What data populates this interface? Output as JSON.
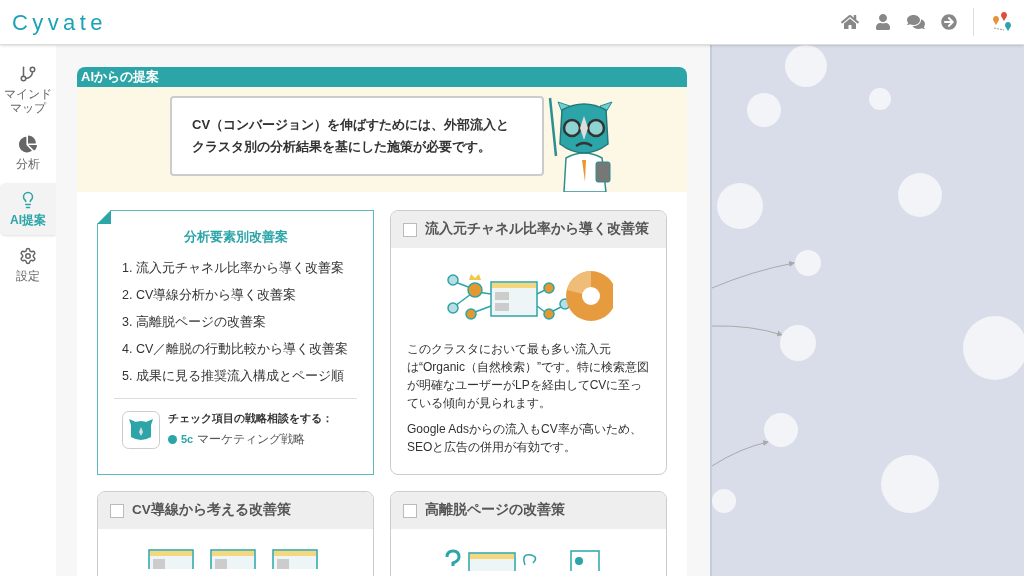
{
  "header": {
    "logo": "Cyvate"
  },
  "sidebar": {
    "items": [
      {
        "kind": "mindmap",
        "label": "マインドマップ",
        "selected": false
      },
      {
        "kind": "analysis",
        "label": "分析",
        "selected": false
      },
      {
        "kind": "ai",
        "label": "AI提案",
        "selected": true
      },
      {
        "kind": "settings",
        "label": "設定",
        "selected": false
      }
    ]
  },
  "panel": {
    "title": "AIからの提案",
    "message": "CV（コンバージョン）を伸ばすためには、外部流入とクラスタ別の分析結果を基にした施策が必要です。"
  },
  "summary": {
    "title": "分析要素別改善案",
    "items": [
      "1. 流入元チャネル比率から導く改善案",
      "2. CV導線分析から導く改善案",
      "3. 高離脱ページの改善案",
      "4. CV／離脱の行動比較から導く改善案",
      "5. 成果に見る推奨流入構成とページ順"
    ],
    "consult": {
      "label": "チェック項目の戦略相談をする：",
      "tag": "5c",
      "tag_text": "マーケティング戦略"
    }
  },
  "proposals": [
    {
      "kind": "channel",
      "title": "流入元チャネル比率から導く改善策",
      "checked": false,
      "paragraphs": [
        "このクラスタにおいて最も多い流入元は“Organic（自然検索）”です。特に検索意図が明確なユーザーがLPを経由してCVに至っている傾向が見られます。",
        "Google Adsからの流入もCV率が高いため、SEOと広告の併用が有効です。"
      ]
    },
    {
      "kind": "funnel",
      "title": "CV導線から考える改善策",
      "checked": false
    },
    {
      "kind": "exit",
      "title": "高離脱ページの改善策",
      "checked": false
    }
  ]
}
